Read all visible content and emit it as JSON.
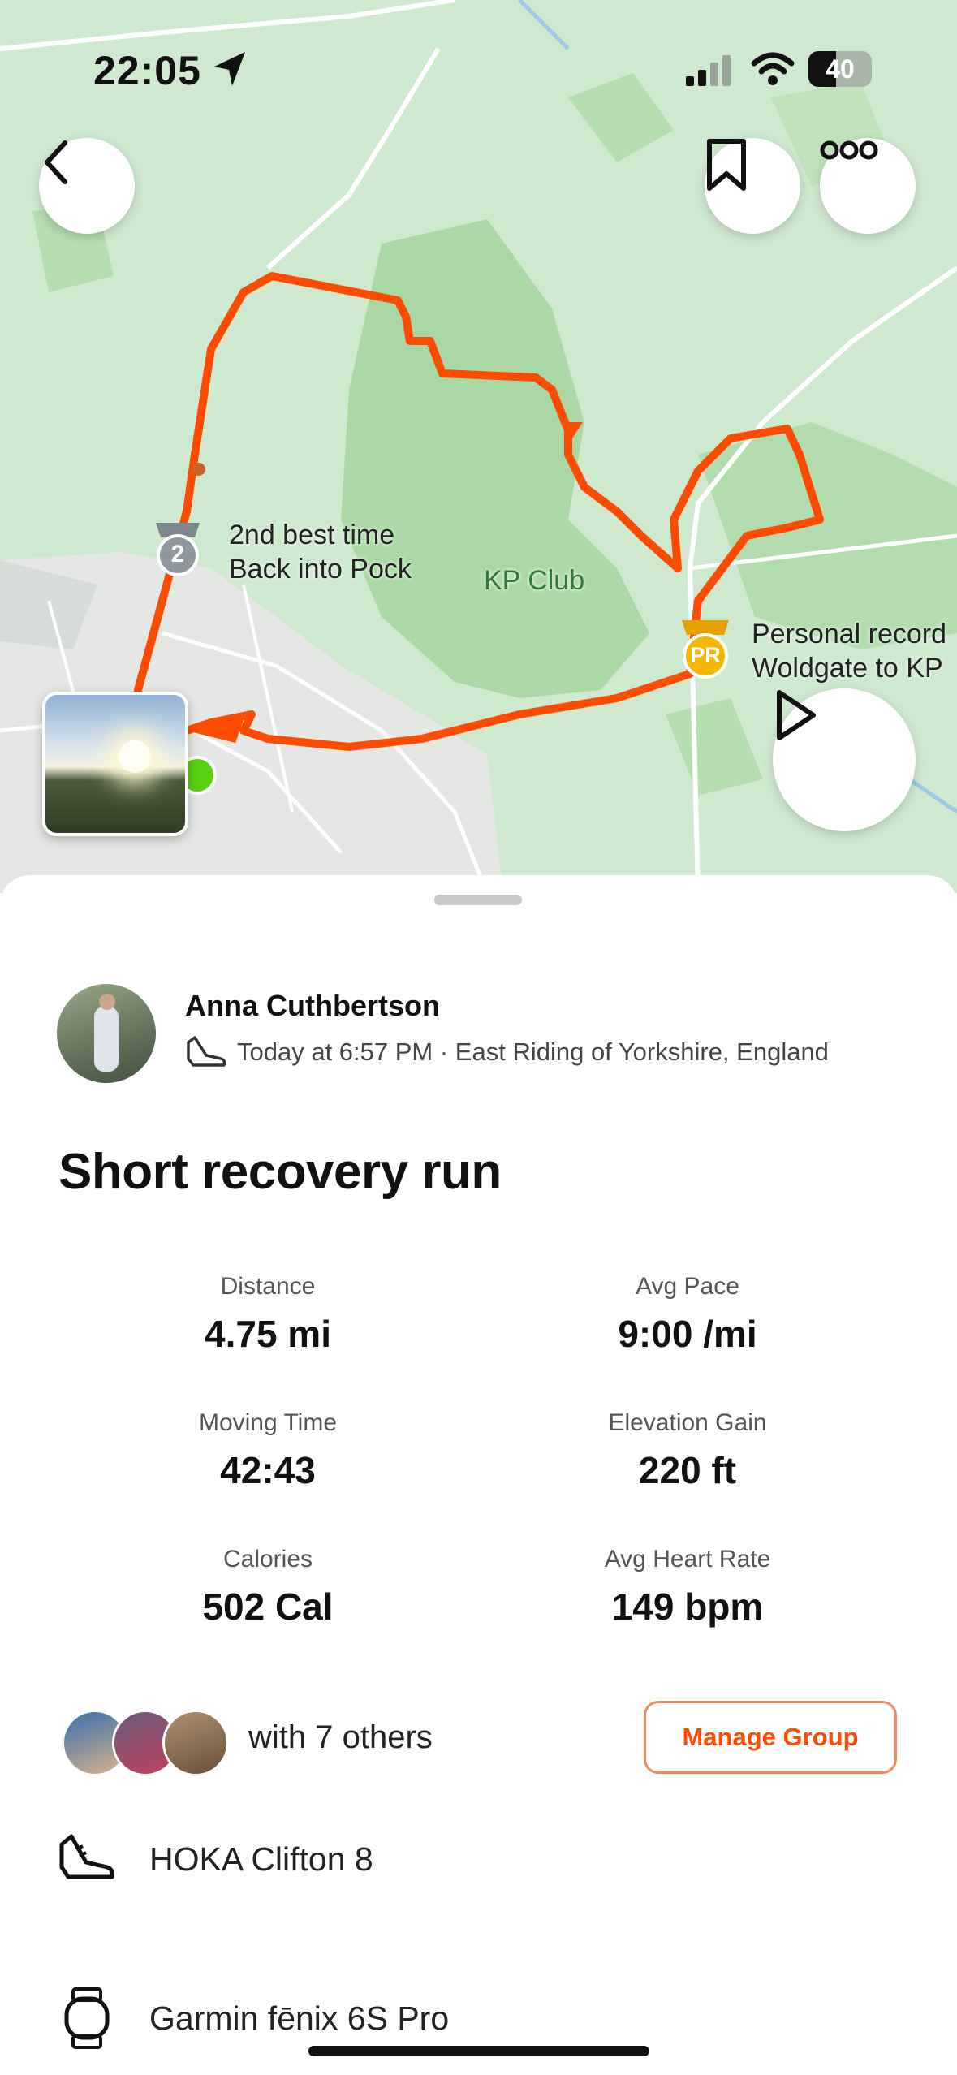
{
  "status_bar": {
    "time": "22:05",
    "battery": "40"
  },
  "map": {
    "labels": {
      "second_best": "2nd best time",
      "segment_1": "Back into Pock",
      "place": "KP Club",
      "pr_title": "Personal record",
      "segment_2": "Woldgate to KP",
      "medal_2": "2",
      "pr_badge": "PR"
    }
  },
  "activity": {
    "athlete": "Anna Cuthbertson",
    "meta": "Today at 6:57 PM · East Riding of Yorkshire, England",
    "title": "Short recovery run",
    "stats": [
      {
        "label": "Distance",
        "value": "4.75 mi"
      },
      {
        "label": "Avg Pace",
        "value": "9:00 /mi"
      },
      {
        "label": "Moving Time",
        "value": "42:43"
      },
      {
        "label": "Elevation Gain",
        "value": "220 ft"
      },
      {
        "label": "Calories",
        "value": "502 Cal"
      },
      {
        "label": "Avg Heart Rate",
        "value": "149 bpm"
      }
    ],
    "group_text": "with 7 others",
    "manage_group": "Manage Group",
    "shoes": "HOKA Clifton 8",
    "device": "Garmin fēnix 6S Pro"
  },
  "colors": {
    "accent": "#fc4c02",
    "route": "#fc4c02",
    "map_green": "#cfe9cf"
  },
  "icons": [
    "back-icon",
    "bookmark-icon",
    "more-icon",
    "play-icon",
    "shoe-icon",
    "watch-icon",
    "location-arrow-icon"
  ]
}
